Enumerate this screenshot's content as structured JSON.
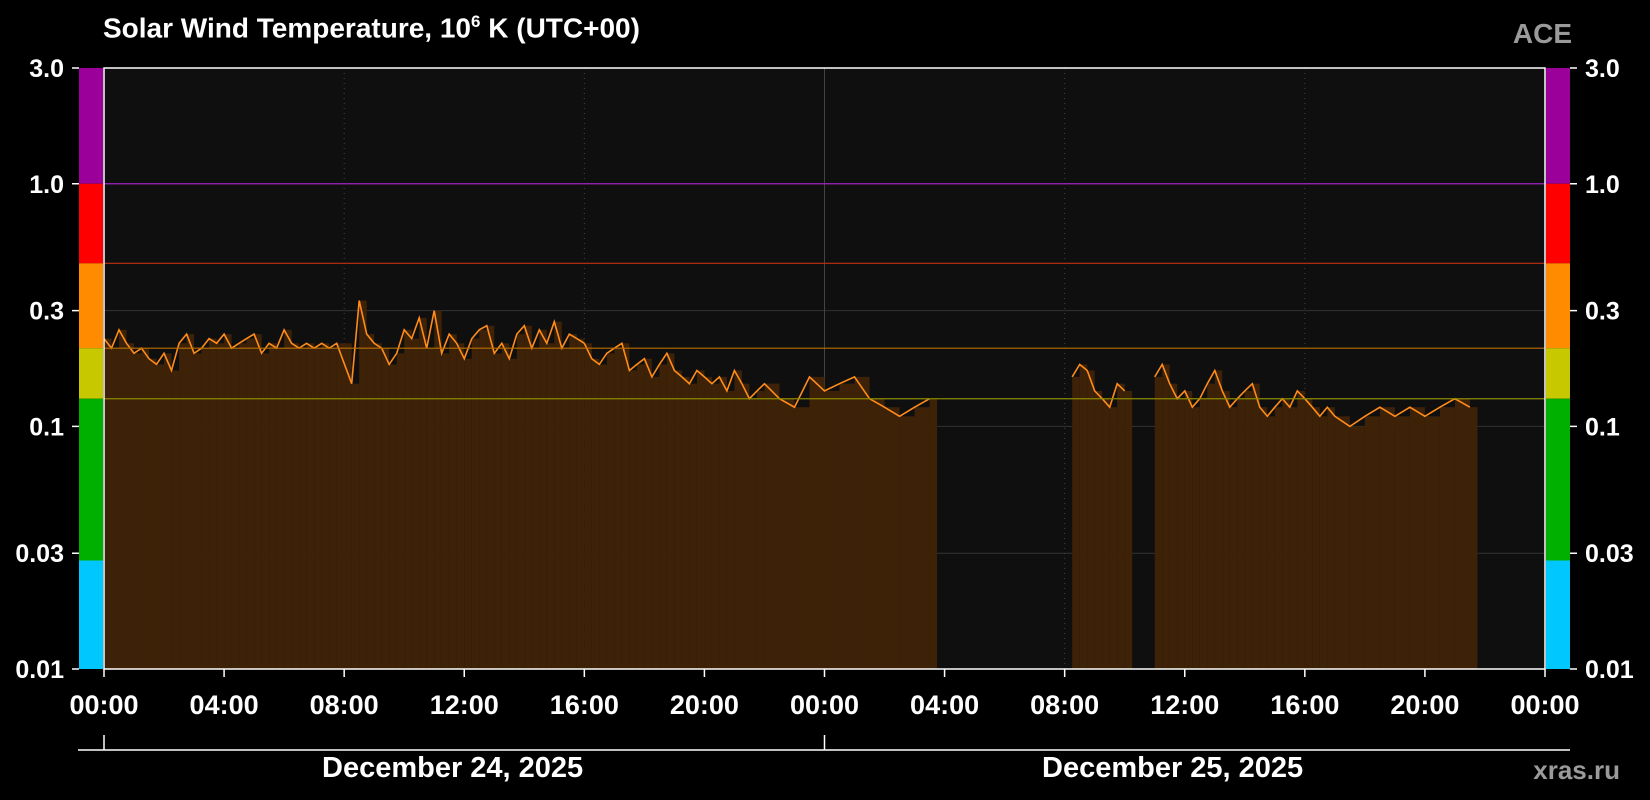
{
  "title_main": "Solar Wind Temperature, 10",
  "title_sup": "6",
  "title_tail": " K (UTC+00)",
  "source": "ACE",
  "site": "xras.ru",
  "dates": [
    "December 24, 2025",
    "December 25, 2025"
  ],
  "colors": {
    "trace": "#ff8c1a",
    "fill": "#3d2208",
    "plot_bg": "#0f0f0f"
  },
  "chart_data": {
    "type": "area",
    "title": "Solar Wind Temperature, 10^6 K (UTC+00)",
    "xlabel": "",
    "ylabel": "",
    "yscale": "log",
    "ylim": [
      0.01,
      3.0
    ],
    "xlim_hours": [
      0,
      48
    ],
    "y_ticks": [
      0.01,
      0.03,
      0.1,
      0.3,
      1.0,
      3.0
    ],
    "y_tick_labels": [
      "0.01",
      "0.03",
      "0.1",
      "0.3",
      "1.0",
      "3.0"
    ],
    "x_tick_labels": [
      "00:00",
      "04:00",
      "08:00",
      "12:00",
      "16:00",
      "20:00",
      "00:00",
      "04:00",
      "08:00",
      "12:00",
      "16:00",
      "20:00",
      "00:00"
    ],
    "grid": true,
    "threshold_lines": [
      {
        "value": 1.0,
        "color": "#a020c0"
      },
      {
        "value": 0.47,
        "color": "#c03010"
      },
      {
        "value": 0.21,
        "color": "#b86e00"
      },
      {
        "value": 0.13,
        "color": "#8a8a00"
      }
    ],
    "color_scale": [
      {
        "from": 1.0,
        "to": 3.0,
        "color": "#9b009b"
      },
      {
        "from": 0.47,
        "to": 1.0,
        "color": "#ff0000"
      },
      {
        "from": 0.21,
        "to": 0.47,
        "color": "#ff8c00"
      },
      {
        "from": 0.13,
        "to": 0.21,
        "color": "#c8c800"
      },
      {
        "from": 0.028,
        "to": 0.13,
        "color": "#00b000"
      },
      {
        "from": 0.01,
        "to": 0.028,
        "color": "#00c8ff"
      }
    ],
    "series": [
      {
        "hours": [
          0.0,
          0.25,
          0.5,
          0.75,
          1.0,
          1.25,
          1.5,
          1.75,
          2.0,
          2.25,
          2.5,
          2.75,
          3.0,
          3.25,
          3.5,
          3.75,
          4.0,
          4.25,
          4.5,
          4.75,
          5.0,
          5.25,
          5.5,
          5.75,
          6.0,
          6.25,
          6.5,
          6.75,
          7.0,
          7.25,
          7.5,
          7.75,
          8.25,
          8.5,
          8.75,
          9.0,
          9.25,
          9.5,
          9.75,
          10.0,
          10.25,
          10.5,
          10.75,
          11.0,
          11.25,
          11.5,
          11.75,
          12.0,
          12.25,
          12.5,
          12.75,
          13.0,
          13.25,
          13.5,
          13.75,
          14.0,
          14.25,
          14.5,
          14.75,
          15.0,
          15.25,
          15.5,
          15.75,
          16.0,
          16.25,
          16.5,
          16.75,
          17.0,
          17.25,
          17.5,
          17.75,
          18.0,
          18.25,
          18.5,
          18.75,
          19.0,
          19.25,
          19.5,
          19.75,
          20.0,
          20.25,
          20.5,
          20.75,
          21.0,
          21.25,
          21.5,
          21.75,
          22.0,
          22.5,
          23.0,
          23.5,
          24.0,
          24.5,
          25.0,
          25.5,
          26.0,
          26.5,
          27.0,
          27.5,
          32.25,
          32.5,
          32.75,
          33.0,
          33.25,
          33.5,
          33.75,
          34.0,
          35.0,
          35.25,
          35.5,
          35.75,
          36.0,
          36.25,
          36.5,
          36.75,
          37.0,
          37.25,
          37.5,
          37.75,
          38.0,
          38.25,
          38.5,
          38.75,
          39.0,
          39.25,
          39.5,
          39.75,
          40.0,
          40.25,
          40.5,
          40.75,
          41.0,
          41.5,
          42.0,
          42.5,
          43.0,
          43.5,
          44.0,
          44.5,
          45.0,
          45.5
        ],
        "values": [
          0.23,
          0.21,
          0.25,
          0.22,
          0.2,
          0.21,
          0.19,
          0.18,
          0.2,
          0.17,
          0.22,
          0.24,
          0.2,
          0.21,
          0.23,
          0.22,
          0.24,
          0.21,
          0.22,
          0.23,
          0.24,
          0.2,
          0.22,
          0.21,
          0.25,
          0.22,
          0.21,
          0.22,
          0.21,
          0.22,
          0.21,
          0.22,
          0.15,
          0.33,
          0.24,
          0.22,
          0.21,
          0.18,
          0.2,
          0.25,
          0.23,
          0.28,
          0.21,
          0.3,
          0.2,
          0.24,
          0.22,
          0.19,
          0.23,
          0.25,
          0.26,
          0.2,
          0.22,
          0.19,
          0.24,
          0.26,
          0.21,
          0.25,
          0.22,
          0.27,
          0.21,
          0.24,
          0.23,
          0.22,
          0.19,
          0.18,
          0.2,
          0.21,
          0.22,
          0.17,
          0.18,
          0.19,
          0.16,
          0.18,
          0.2,
          0.17,
          0.16,
          0.15,
          0.17,
          0.16,
          0.15,
          0.16,
          0.14,
          0.17,
          0.15,
          0.13,
          0.14,
          0.15,
          0.13,
          0.12,
          0.16,
          0.14,
          0.15,
          0.16,
          0.13,
          0.12,
          0.11,
          0.12,
          0.13,
          0.16,
          0.18,
          0.17,
          0.14,
          0.13,
          0.12,
          0.15,
          0.14,
          0.16,
          0.18,
          0.15,
          0.13,
          0.14,
          0.12,
          0.13,
          0.15,
          0.17,
          0.14,
          0.12,
          0.13,
          0.14,
          0.15,
          0.12,
          0.11,
          0.12,
          0.13,
          0.12,
          0.14,
          0.13,
          0.12,
          0.11,
          0.12,
          0.11,
          0.1,
          0.11,
          0.12,
          0.11,
          0.12,
          0.11,
          0.12,
          0.13,
          0.12
        ]
      }
    ]
  }
}
